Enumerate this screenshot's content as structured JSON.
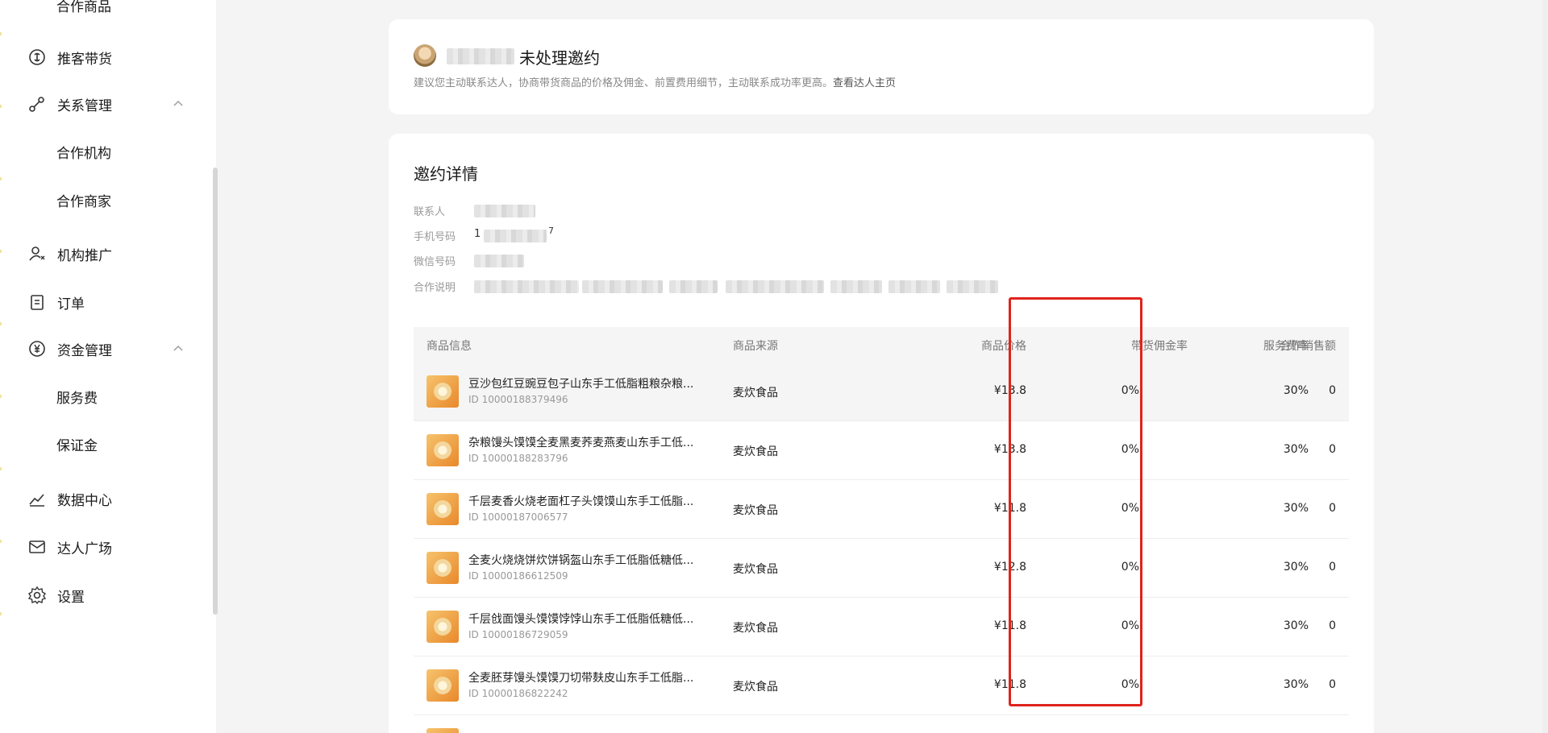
{
  "sidebar": {
    "items": [
      {
        "label": "合作商品",
        "icon": "none"
      },
      {
        "label": "推客带货",
        "icon": "share-icon"
      },
      {
        "label": "关系管理",
        "icon": "relation-icon",
        "expanded": true
      },
      {
        "label": "合作机构",
        "icon": "none"
      },
      {
        "label": "合作商家",
        "icon": "none"
      },
      {
        "label": "机构推广",
        "icon": "user-promote-icon"
      },
      {
        "label": "订单",
        "icon": "clipboard-icon"
      },
      {
        "label": "资金管理",
        "icon": "yen-icon",
        "expanded": true
      },
      {
        "label": "服务费",
        "icon": "none"
      },
      {
        "label": "保证金",
        "icon": "none"
      },
      {
        "label": "数据中心",
        "icon": "trend-icon"
      },
      {
        "label": "达人广场",
        "icon": "mail-icon"
      },
      {
        "label": "设置",
        "icon": "gear-icon"
      }
    ]
  },
  "invite": {
    "title": "未处理邀约",
    "hint": "建议您主动联系达人，协商带货商品的价格及佣金、前置费用细节，主动联系成功率更高。",
    "hint_link": "查看达人主页"
  },
  "details": {
    "title": "邀约详情",
    "contact_label": "联系人",
    "phone_label": "手机号码",
    "phone_visible_start": "1",
    "phone_visible_end": "7",
    "wechat_label": "微信号码",
    "note_label": "合作说明"
  },
  "table": {
    "headers": {
      "info": "商品信息",
      "source": "商品来源",
      "price": "商品价格",
      "commission": "带货佣金率",
      "service": "服务费率",
      "sales": "合作销售额"
    },
    "rows": [
      {
        "name": "豆沙包红豆豌豆包子山东手工低脂粗粮杂粮...",
        "id": "ID 10000188379496",
        "source": "麦炊食品",
        "price": "¥13.8",
        "commission": "0%",
        "service": "30%",
        "sales": "0"
      },
      {
        "name": "杂粮馒头馍馍全麦黑麦荞麦燕麦山东手工低...",
        "id": "ID 10000188283796",
        "source": "麦炊食品",
        "price": "¥13.8",
        "commission": "0%",
        "service": "30%",
        "sales": "0"
      },
      {
        "name": "千层麦香火烧老面杠子头馍馍山东手工低脂...",
        "id": "ID 10000187006577",
        "source": "麦炊食品",
        "price": "¥11.8",
        "commission": "0%",
        "service": "30%",
        "sales": "0"
      },
      {
        "name": "全麦火烧烧饼炊饼锅盔山东手工低脂低糖低...",
        "id": "ID 10000186612509",
        "source": "麦炊食品",
        "price": "¥12.8",
        "commission": "0%",
        "service": "30%",
        "sales": "0"
      },
      {
        "name": "千层戗面馒头馍馍饽饽山东手工低脂低糖低...",
        "id": "ID 10000186729059",
        "source": "麦炊食品",
        "price": "¥11.8",
        "commission": "0%",
        "service": "30%",
        "sales": "0"
      },
      {
        "name": "全麦胚芽馒头馍馍刀切带麸皮山东手工低脂...",
        "id": "ID 10000186822242",
        "source": "麦炊食品",
        "price": "¥11.8",
        "commission": "0%",
        "service": "30%",
        "sales": "0"
      }
    ]
  },
  "colors": {
    "highlight_box": "#e0231c"
  }
}
